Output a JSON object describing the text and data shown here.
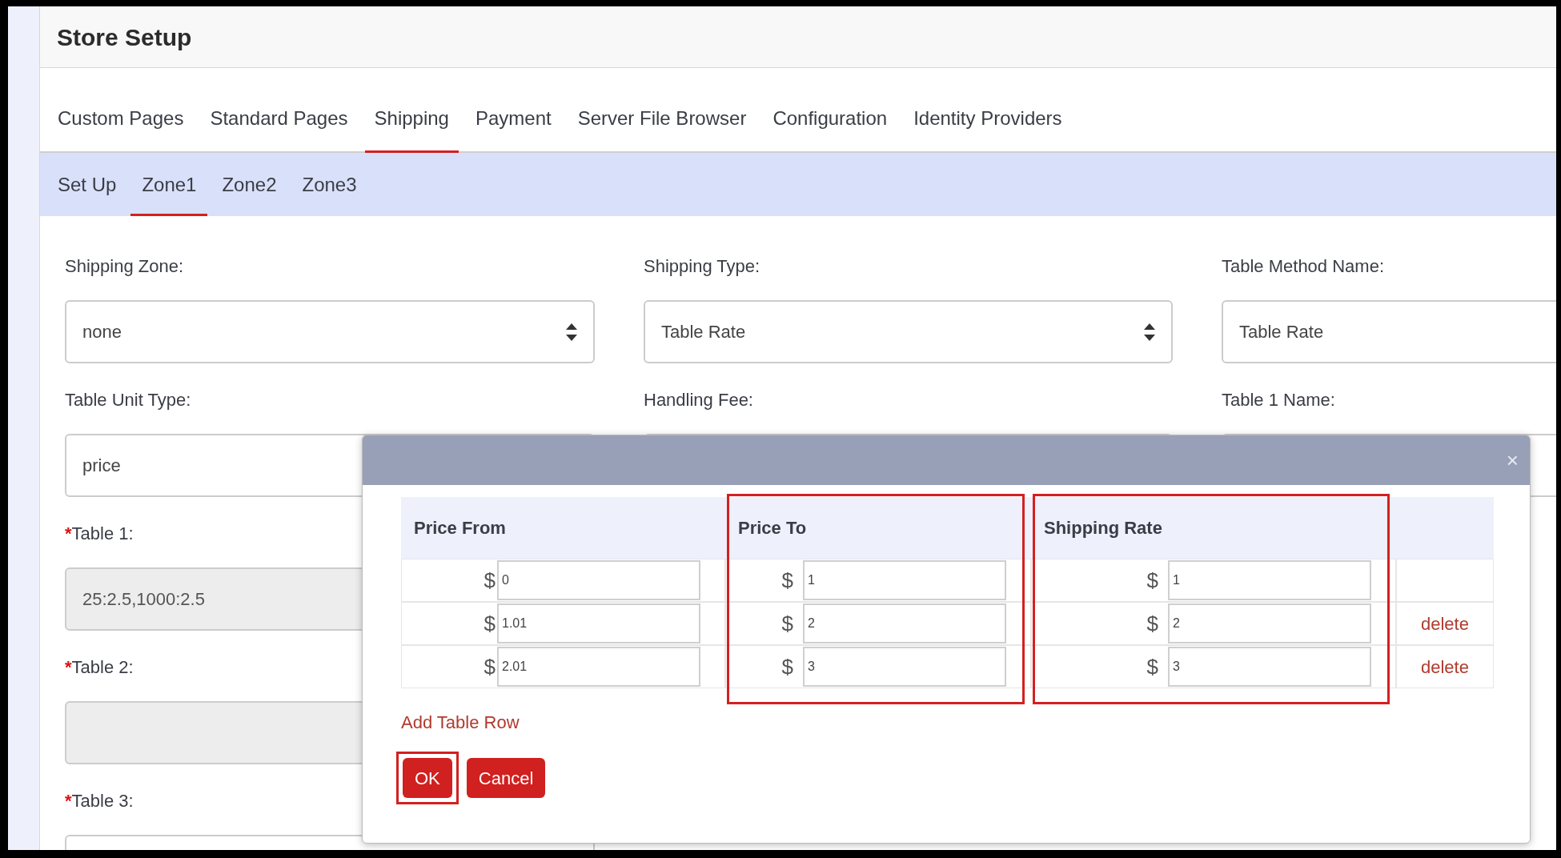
{
  "header": {
    "title": "Store Setup"
  },
  "tabs": [
    {
      "label": "Custom Pages",
      "selected": false
    },
    {
      "label": "Standard Pages",
      "selected": false
    },
    {
      "label": "Shipping",
      "selected": true
    },
    {
      "label": "Payment",
      "selected": false
    },
    {
      "label": "Server File Browser",
      "selected": false
    },
    {
      "label": "Configuration",
      "selected": false
    },
    {
      "label": "Identity Providers",
      "selected": false
    }
  ],
  "subtabs": [
    {
      "label": "Set Up",
      "selected": false
    },
    {
      "label": "Zone1",
      "selected": true
    },
    {
      "label": "Zone2",
      "selected": false
    },
    {
      "label": "Zone3",
      "selected": false
    }
  ],
  "form": {
    "rows": [
      [
        {
          "label": "Shipping Zone:",
          "kind": "select",
          "value": "none"
        },
        {
          "label": "Shipping Type:",
          "kind": "select",
          "value": "Table Rate"
        },
        {
          "label": "Table Method Name:",
          "kind": "input",
          "value": "Table Rate"
        }
      ],
      [
        {
          "label": "Table Unit Type:",
          "kind": "input",
          "value": "price"
        },
        {
          "label": "Handling Fee:",
          "kind": "input"
        },
        {
          "label": "Table 1 Name:",
          "kind": "input"
        }
      ],
      [
        {
          "required_mark": "*",
          "label": "Table 1:",
          "kind": "input",
          "value": "25:2.5,1000:2.5",
          "disabled": true
        }
      ],
      [
        {
          "required_mark": "*",
          "label": "Table 2:",
          "kind": "input",
          "disabled": true
        }
      ],
      [
        {
          "required_mark": "*",
          "label": "Table 3:",
          "kind": "input"
        }
      ]
    ]
  },
  "dialog": {
    "close": "×",
    "columns": [
      {
        "label": "Price From",
        "highlighted": false
      },
      {
        "label": "Price To",
        "highlighted": true
      },
      {
        "label": "Shipping Rate",
        "highlighted": true
      }
    ],
    "rows": [
      {
        "cells": [
          {
            "prefix": "$",
            "value": "0"
          },
          {
            "prefix": "$",
            "value": "1"
          },
          {
            "prefix": "$",
            "value": "1"
          }
        ]
      },
      {
        "cells": [
          {
            "prefix": "$",
            "value": "1.01"
          },
          {
            "prefix": "$",
            "value": "2"
          },
          {
            "prefix": "$",
            "value": "2"
          }
        ],
        "action": "delete"
      },
      {
        "cells": [
          {
            "prefix": "$",
            "value": "2.01"
          },
          {
            "prefix": "$",
            "value": "3"
          },
          {
            "prefix": "$",
            "value": "3"
          }
        ],
        "action": "delete"
      }
    ],
    "add_row": "Add Table Row",
    "buttons": [
      {
        "label": "OK",
        "highlighted": true
      },
      {
        "label": "Cancel",
        "highlighted": false
      }
    ]
  }
}
